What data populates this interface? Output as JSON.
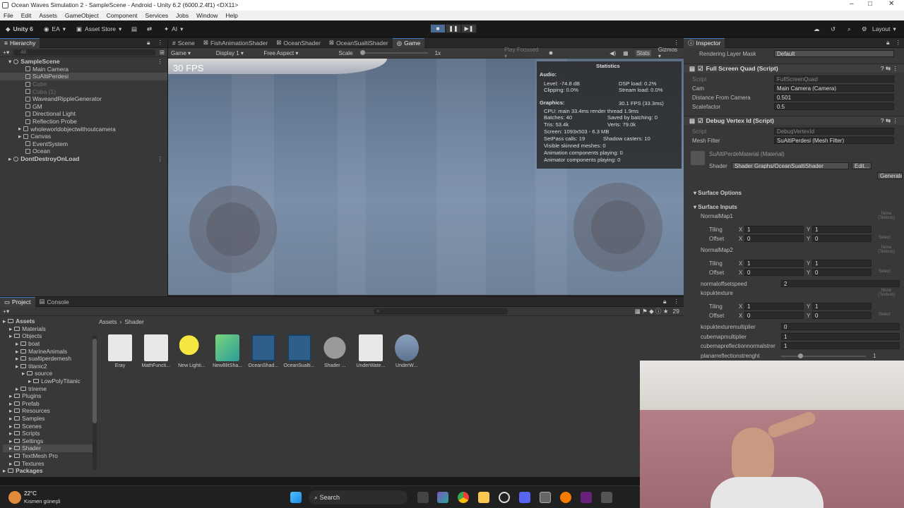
{
  "window": {
    "title": "Ocean Waves Simulation 2 - SampleScene - Android - Unity 6.2 (6000.2.4f1) <DX11>"
  },
  "menu": [
    "File",
    "Edit",
    "Assets",
    "GameObject",
    "Component",
    "Services",
    "Jobs",
    "Window",
    "Help"
  ],
  "toolbar": {
    "account": "Unity 6",
    "user": "EA",
    "asset_store": "Asset Store",
    "ai": "AI",
    "layout": "Layout"
  },
  "hierarchy": {
    "tab": "Hierarchy",
    "search_placeholder": "All",
    "items": [
      {
        "label": "SampleScene",
        "indent": 0,
        "kind": "scene"
      },
      {
        "label": "Main Camera",
        "indent": 1,
        "kind": "obj"
      },
      {
        "label": "SuAltiPerdesi",
        "indent": 1,
        "kind": "obj",
        "selected": true
      },
      {
        "label": "Cube",
        "indent": 1,
        "kind": "obj",
        "dim": true
      },
      {
        "label": "Cuba (1)",
        "indent": 1,
        "kind": "obj",
        "dim": true
      },
      {
        "label": "WaveandRippleGenerator",
        "indent": 1,
        "kind": "obj"
      },
      {
        "label": "GM",
        "indent": 1,
        "kind": "obj"
      },
      {
        "label": "Directional Light",
        "indent": 1,
        "kind": "obj"
      },
      {
        "label": "Reflection Probe",
        "indent": 1,
        "kind": "obj"
      },
      {
        "label": "wholeworldobjectwithoutcamera",
        "indent": 1,
        "kind": "obj",
        "expand": true
      },
      {
        "label": "Canvas",
        "indent": 1,
        "kind": "obj",
        "expand": true
      },
      {
        "label": "EventSystem",
        "indent": 1,
        "kind": "obj"
      },
      {
        "label": "Ocean",
        "indent": 1,
        "kind": "obj"
      },
      {
        "label": "DontDestroyOnLoad",
        "indent": 0,
        "kind": "scene"
      }
    ]
  },
  "scene_tabs": [
    "Scene",
    "FishAnimationShader",
    "OceanShader",
    "OceanSualtiShader",
    "Game"
  ],
  "game_bar": {
    "mode": "Game",
    "display": "Display 1",
    "aspect": "Free Aspect",
    "scale_label": "Scale",
    "scale_value": "1x",
    "play_focused": "Play Focused",
    "stats": "Stats",
    "gizmos": "Gizmos"
  },
  "game_view": {
    "fps": "30 FPS"
  },
  "statistics": {
    "title": "Statistics",
    "audio_label": "Audio:",
    "level": "Level: -74.8 dB",
    "clipping": "Clipping: 0.0%",
    "dsp": "DSP load: 0.2%",
    "stream": "Stream load: 0.0%",
    "graphics_label": "Graphics:",
    "fps": "30.1 FPS (33.3ms)",
    "cpu": "CPU: main 33.4ms  render thread 1.9ms",
    "batches": "Batches: 40",
    "saved": "Saved by batching: 0",
    "tris": "Tris: 53.4k",
    "verts": "Verts: 79.0k",
    "screen": "Screen: 1093x503 - 6.3 MB",
    "setpass": "SetPass calls: 19",
    "shadow": "Shadow casters: 10",
    "skinned": "Visible skinned meshes: 0",
    "anim": "Animation components playing: 0",
    "animator": "Animator components playing: 0"
  },
  "inspector": {
    "tab": "Inspector",
    "rendering_layer_label": "Rendering Layer Mask",
    "rendering_layer_value": "Default",
    "comp1_title": "Full Screen Quad (Script)",
    "script_label": "Script",
    "comp1_script": "FullScreenQuad",
    "cam_label": "Cam",
    "cam_value": "Main Camera (Camera)",
    "dist_label": "Distance From Camera",
    "dist_value": "0.501",
    "scale_label": "Scalefactor",
    "scale_value": "0.5",
    "comp2_title": "Debug Vertex Id (Script)",
    "comp2_script": "DebugVertexId",
    "mesh_label": "Mesh Filter",
    "mesh_value": "SuAltiPerdesi (Mesh Filter)",
    "material_title": "SuAltiPerdeMaterial (Material)",
    "shader_label": "Shader",
    "shader_value": "Shader Graphs/OceanSualtiShader",
    "edit_btn": "Edit...",
    "generate_btn": "Generate",
    "surface_options": "Surface Options",
    "surface_inputs": "Surface Inputs",
    "normalmap1": "NormalMap1",
    "normalmap2": "NormalMap2",
    "tiling": "Tiling",
    "offset": "Offset",
    "x": "X",
    "y": "Y",
    "one": "1",
    "zero": "0",
    "none_texture": "None (Texture)",
    "select": "Select",
    "normaloffsetspeed_label": "normaloffsetspeed",
    "normaloffsetspeed_value": "2",
    "kopuk_label": "kopuktexture",
    "kopukmult_label": "kopuktexturemultiplier",
    "kopukmult_value": "0",
    "cubemult_label": "cubemapmultiplier",
    "cubemult_value": "1",
    "cuberefl_label": "cubemapreflectionnormalstrer",
    "cuberefl_value": "1",
    "planar_label": "planarreflectionstrenght",
    "planar_value": "1"
  },
  "project": {
    "tabs": [
      "Project",
      "Console"
    ],
    "breadcrumb": [
      "Assets",
      "Shader"
    ],
    "count": "29",
    "tree": [
      {
        "label": "Assets",
        "indent": 0,
        "bold": true
      },
      {
        "label": "Materials",
        "indent": 1
      },
      {
        "label": "Objects",
        "indent": 1
      },
      {
        "label": "boat",
        "indent": 2
      },
      {
        "label": "MarineAnimals",
        "indent": 2
      },
      {
        "label": "sualtiperdemesh",
        "indent": 2
      },
      {
        "label": "titanic2",
        "indent": 2
      },
      {
        "label": "source",
        "indent": 3
      },
      {
        "label": "LowPolyTitanic",
        "indent": 4
      },
      {
        "label": "trireme",
        "indent": 2
      },
      {
        "label": "Plugins",
        "indent": 1
      },
      {
        "label": "Prefab",
        "indent": 1
      },
      {
        "label": "Resources",
        "indent": 1
      },
      {
        "label": "Samples",
        "indent": 1
      },
      {
        "label": "Scenes",
        "indent": 1
      },
      {
        "label": "Scripts",
        "indent": 1
      },
      {
        "label": "Settings",
        "indent": 1
      },
      {
        "label": "Shader",
        "indent": 1,
        "selected": true
      },
      {
        "label": "TextMesh Pro",
        "indent": 1
      },
      {
        "label": "Textures",
        "indent": 1
      },
      {
        "label": "Packages",
        "indent": 0,
        "bold": true
      }
    ],
    "assets": [
      {
        "label": "Eray",
        "kind": "doc"
      },
      {
        "label": "MathFuncti...",
        "kind": "doc"
      },
      {
        "label": "New Lighti...",
        "kind": "light"
      },
      {
        "label": "NewBlitSha...",
        "kind": "shader"
      },
      {
        "label": "OceanShad...",
        "kind": "graph"
      },
      {
        "label": "OceanSualti...",
        "kind": "graph"
      },
      {
        "label": "Shader ...",
        "kind": "sphere"
      },
      {
        "label": "UnderWate...",
        "kind": "doc"
      },
      {
        "label": "UnderW...",
        "kind": "water"
      }
    ]
  },
  "taskbar": {
    "weather_temp": "22°C",
    "weather_desc": "Kısmen güneşli",
    "search": "Search"
  }
}
